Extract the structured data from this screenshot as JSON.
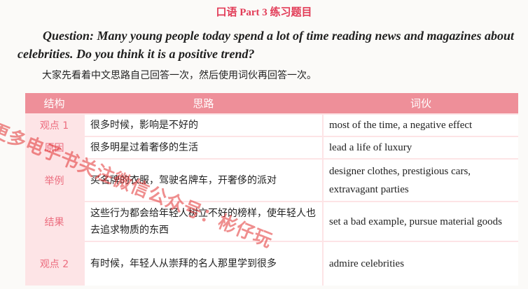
{
  "title": "口语 Part 3 练习题目",
  "question": "Question: Many young people today spend a lot of time reading news and magazines about celebrities. Do you think it is a positive trend?",
  "instruction": "大家先看着中文思路自己回答一次，然后使用词伙再回答一次。",
  "table": {
    "headers": [
      "结构",
      "思路",
      "词伙"
    ],
    "rows": [
      {
        "label": "观点 1",
        "idea": "很多时候，影响是不好的",
        "phrase": "most of the time, a negative effect"
      },
      {
        "label": "原因",
        "idea": "很多明星过着奢侈的生活",
        "phrase": "lead a life of luxury"
      },
      {
        "label": "举例",
        "idea": "买名牌的衣服，驾驶名牌车，开奢侈的派对",
        "phrase": "designer clothes, prestigious cars, extravagant parties"
      },
      {
        "label": "结果",
        "idea": "这些行为都会给年轻人树立不好的榜样，使年轻人也去追求物质的东西",
        "phrase": "set a bad example, pursue material goods"
      },
      {
        "label": "观点 2",
        "idea": "有时候，年轻人从崇拜的名人那里学到很多",
        "phrase": "admire celebrities"
      }
    ]
  },
  "watermark": "更多电子书关注微信公众号：彬仔玩"
}
